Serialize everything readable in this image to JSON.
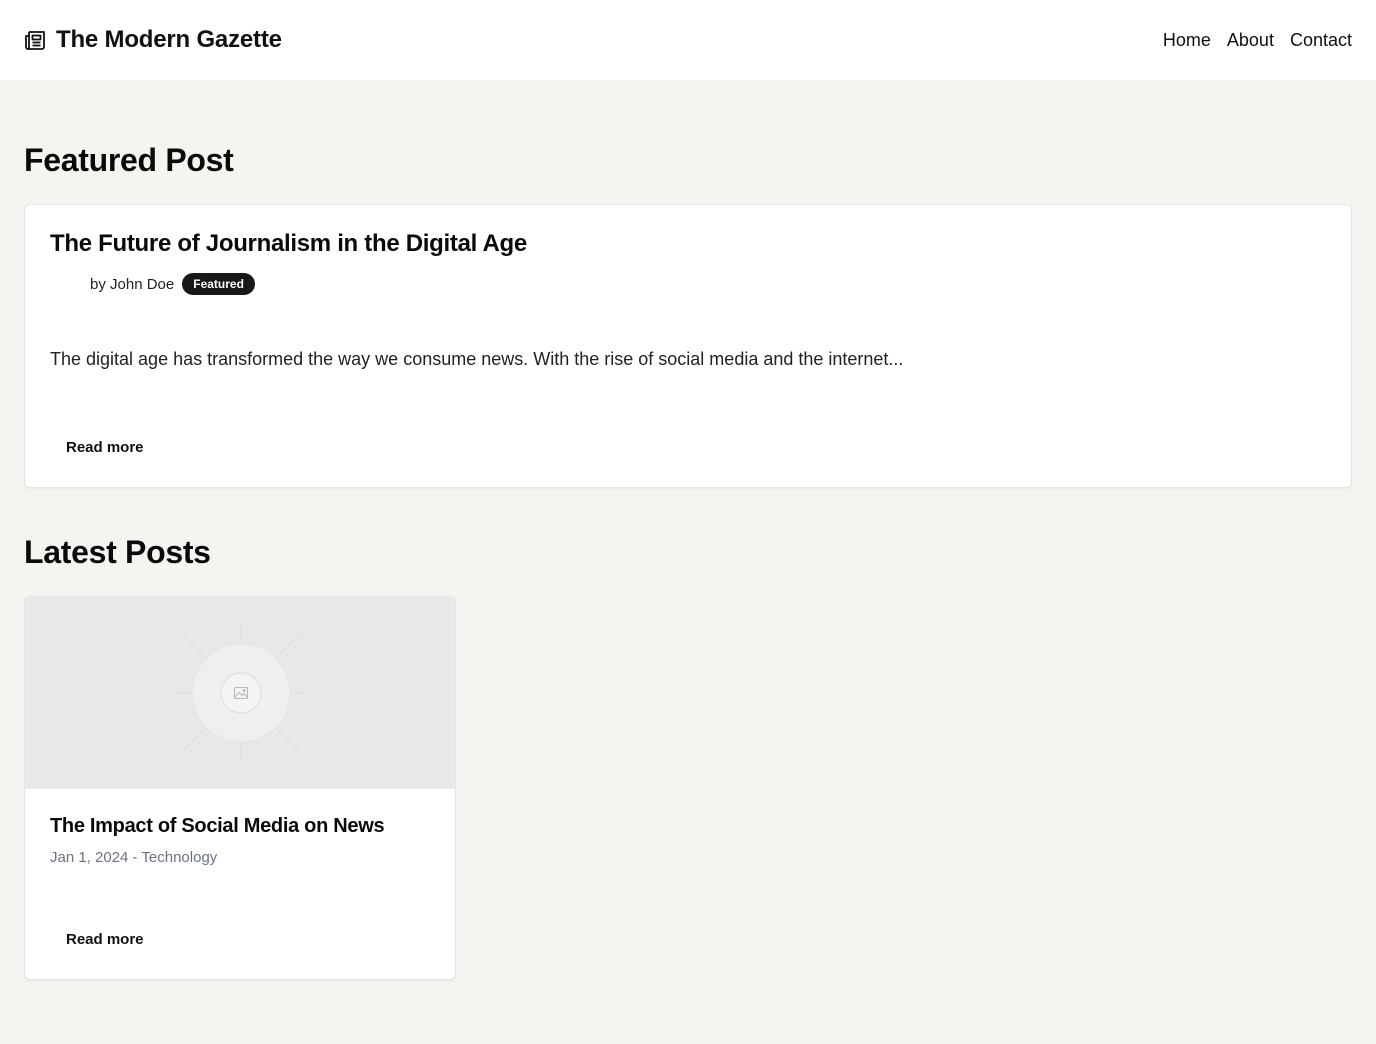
{
  "header": {
    "brand_icon": "newspaper-icon",
    "title": "The Modern Gazette",
    "nav": [
      "Home",
      "About",
      "Contact"
    ]
  },
  "featured_section": {
    "heading": "Featured Post",
    "post": {
      "title": "The Future of Journalism in the Digital Age",
      "author": "by John Doe",
      "badge": "Featured",
      "excerpt": "The digital age has transformed the way we consume news. With the rise of social media and the internet...",
      "read_more": "Read more"
    }
  },
  "latest_section": {
    "heading": "Latest Posts",
    "posts": [
      {
        "image_icon": "image-placeholder-icon",
        "title": "The Impact of Social Media on News",
        "date": "Jan 1, 2024",
        "separator": "-",
        "category": "Technology",
        "read_more": "Read more"
      }
    ]
  },
  "colors": {
    "page_background": "#f5f4f0",
    "header_background": "#ffffff",
    "badge_background": "#18181b",
    "muted_text": "#6b7280"
  }
}
